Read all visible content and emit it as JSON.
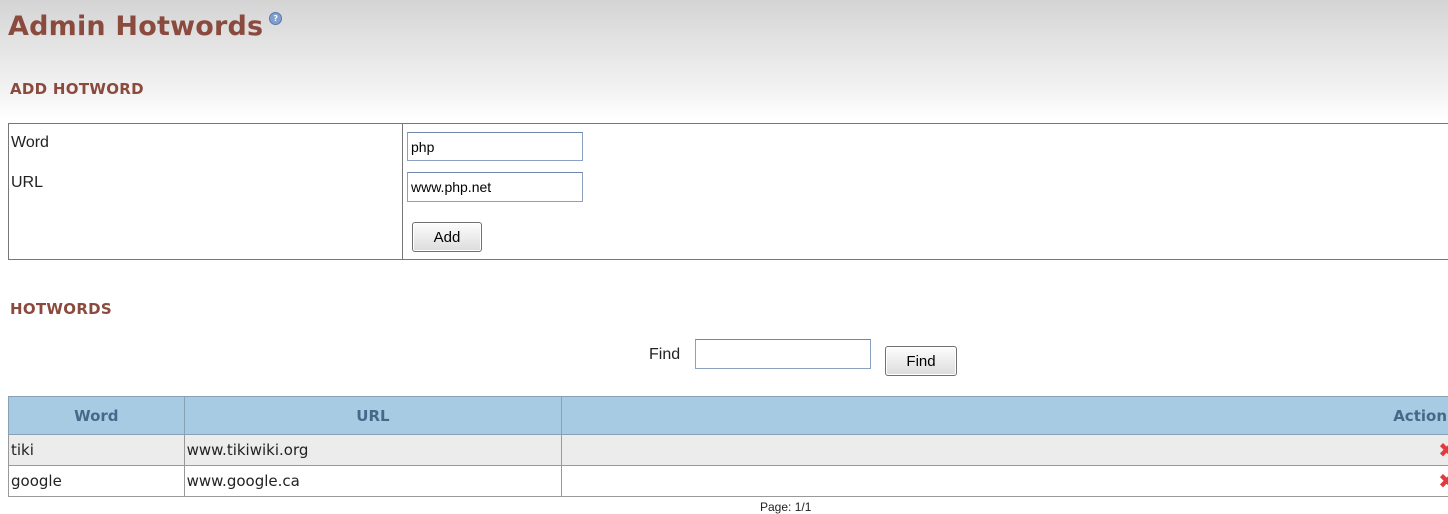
{
  "page": {
    "title": "Admin Hotwords",
    "help_icon": "help-icon"
  },
  "add_section": {
    "title": "ADD HOTWORD",
    "word_label": "Word",
    "word_value": "php",
    "url_label": "URL",
    "url_value": "www.php.net",
    "add_button": "Add"
  },
  "hotwords_section": {
    "title": "HOTWORDS",
    "find_label": "Find",
    "find_value": "",
    "find_button": "Find"
  },
  "table": {
    "columns": [
      "Word",
      "URL",
      "Action"
    ],
    "rows": [
      {
        "word": "tiki",
        "url": "www.tikiwiki.org",
        "action_icon": "delete-icon"
      },
      {
        "word": "google",
        "url": "www.google.ca",
        "action_icon": "delete-icon"
      }
    ]
  },
  "pagination": {
    "text": "Page: 1/1"
  },
  "colors": {
    "title": "#8a4a3e",
    "table_header_bg": "#a8cbe4",
    "table_header_text": "#46698a",
    "delete_icon": "#e23b3b"
  }
}
